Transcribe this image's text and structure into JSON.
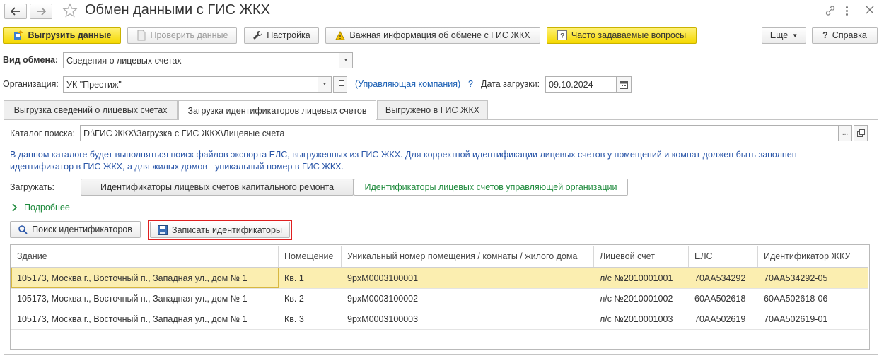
{
  "window": {
    "title": "Обмен данными с ГИС ЖКХ"
  },
  "toolbar": {
    "upload_label": "Выгрузить данные",
    "check_label": "Проверить данные",
    "settings_label": "Настройка",
    "important_label": "Важная информация об обмене с ГИС ЖКХ",
    "faq_label": "Часто задаваемые вопросы",
    "more_label": "Еще",
    "help_label": "Справка"
  },
  "form": {
    "exchange_type_label": "Вид обмена:",
    "exchange_type_value": "Сведения о лицевых счетах",
    "org_label": "Организация:",
    "org_value": "УК \"Престиж\"",
    "org_role_link": "(Управляющая компания)",
    "help_mark": "?",
    "load_date_label": "Дата загрузки:",
    "load_date_value": "09.10.2024"
  },
  "tabs": [
    {
      "label": "Выгрузка сведений о лицевых счетах"
    },
    {
      "label": "Загрузка идентификаторов лицевых счетов"
    },
    {
      "label": "Выгружено в ГИС ЖКХ"
    }
  ],
  "panel": {
    "catalog_label": "Каталог поиска:",
    "catalog_value": "D:\\ГИС ЖКХ\\Загрузка с ГИС ЖКХ\\Лицевые счета",
    "catalog_browse": "...",
    "info_line1": "В данном каталоге будет выполняться поиск файлов экспорта ЕЛС, выгруженных из ГИС ЖКХ. Для корректной идентификации лицевых счетов у помещений и комнат должен быть заполнен",
    "info_line2": "идентификатор в ГИС ЖКХ, а для жилых домов - уникальный номер в ГИС ЖКХ.",
    "load_label": "Загружать:",
    "load_option1": "Идентификаторы лицевых счетов капитального ремонта",
    "load_option2": "Идентификаторы лицевых счетов управляющей организации",
    "details_label": "Подробнее",
    "search_button": "Поиск идентификаторов",
    "write_button": "Записать идентификаторы"
  },
  "table": {
    "columns": [
      "Здание",
      "Помещение",
      "Уникальный номер помещения / комнаты / жилого дома",
      "Лицевой счет",
      "ЕЛС",
      "Идентификатор ЖКУ"
    ],
    "rows": [
      [
        "105173, Москва г., Восточный п., Западная ул., дом № 1",
        "Кв. 1",
        "9pxM0003100001",
        "л/с №2010001001",
        "70AA534292",
        "70AA534292-05"
      ],
      [
        "105173, Москва г., Восточный п., Западная ул., дом № 1",
        "Кв. 2",
        "9pxM0003100002",
        "л/с №2010001002",
        "60AA502618",
        "60AA502618-06"
      ],
      [
        "105173, Москва г., Восточный п., Западная ул., дом № 1",
        "Кв. 3",
        "9pxM0003100003",
        "л/с №2010001003",
        "70AA502619",
        "70AA502619-01"
      ]
    ],
    "selected_row": 0
  },
  "colors": {
    "selected_row": "#fbeeb0",
    "link": "#1a5fb4",
    "info_text": "#2a56a8",
    "green_text": "#1e8a3c",
    "highlight_border": "#e02020"
  }
}
